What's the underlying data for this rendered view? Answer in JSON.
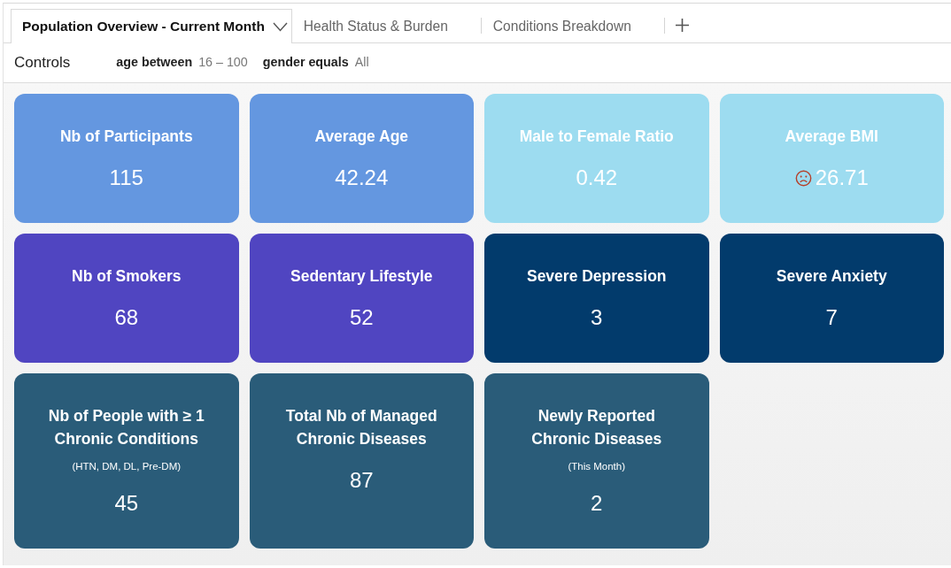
{
  "tabs": [
    {
      "label": "Population Overview - Current Month",
      "selected": true
    },
    {
      "label": "Health Status & Burden",
      "selected": false
    },
    {
      "label": "Conditions Breakdown",
      "selected": false
    }
  ],
  "controls": {
    "label": "Controls",
    "filters": [
      {
        "label": "age between",
        "value": "16 – 100"
      },
      {
        "label": "gender equals",
        "value": "All"
      }
    ]
  },
  "cards": [
    {
      "title": "Nb of Participants",
      "value": "115",
      "color": "#6497e0",
      "warning": false
    },
    {
      "title": "Average Age",
      "value": "42.24",
      "color": "#6497e0",
      "warning": false
    },
    {
      "title": "Male to Female Ratio",
      "value": "0.42",
      "color": "#9ddcf0",
      "warning": false
    },
    {
      "title": "Average BMI",
      "value": "26.71",
      "color": "#9ddcf0",
      "warning": true
    },
    {
      "title": "Nb of Smokers",
      "value": "68",
      "color": "#5045c1",
      "warning": false
    },
    {
      "title": "Sedentary Lifestyle",
      "value": "52",
      "color": "#5045c1",
      "warning": false
    },
    {
      "title": "Severe Depression",
      "value": "3",
      "color": "#023b6c",
      "warning": false
    },
    {
      "title": "Severe Anxiety",
      "value": "7",
      "color": "#023b6c",
      "warning": false
    },
    {
      "title": "Nb of People with ≥ 1 Chronic Conditions",
      "subtitle": "(HTN, DM, DL, Pre-DM)",
      "value": "45",
      "color": "#2a5c79",
      "warning": false
    },
    {
      "title": "Total Nb of Managed Chronic Diseases",
      "value": "87",
      "color": "#2a5c79",
      "warning": false
    },
    {
      "title": "Newly Reported Chronic Diseases",
      "subtitle": "(This Month)",
      "value": "2",
      "color": "#2a5c79",
      "warning": false
    }
  ]
}
